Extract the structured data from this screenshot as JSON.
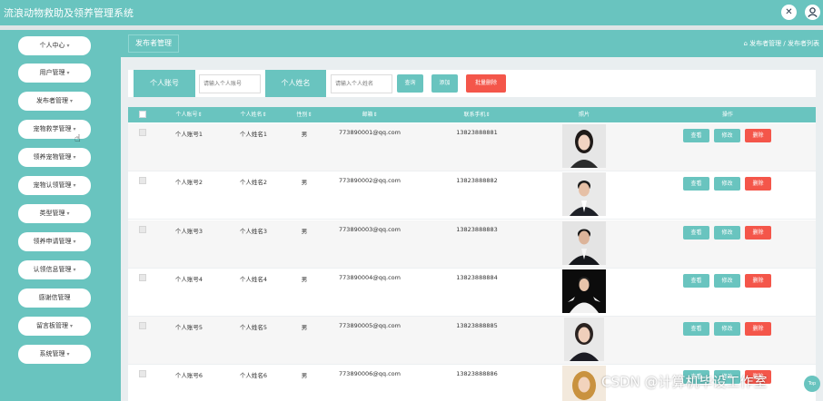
{
  "app": {
    "title": "流浪动物救助及领养管理系统",
    "accent_color": "#69c4bf",
    "danger_color": "#f4564a",
    "header_icons": [
      "close-x-icon",
      "user-icon"
    ]
  },
  "sidebar": {
    "items": [
      {
        "label": "个人中心"
      },
      {
        "label": "用户管理"
      },
      {
        "label": "发布者管理"
      },
      {
        "label": "宠物救学管理"
      },
      {
        "label": "领养宠物管理"
      },
      {
        "label": "宠物认领管理"
      },
      {
        "label": "类型管理"
      },
      {
        "label": "领养申请管理"
      },
      {
        "label": "认领信息管理"
      },
      {
        "label": "感谢信管理"
      },
      {
        "label": "留言板管理"
      },
      {
        "label": "系统管理"
      }
    ]
  },
  "header": {
    "tab": "发布者管理",
    "breadcrumb": {
      "home_icon": "home-icon",
      "level1": "发布者管理",
      "separator": "/",
      "level2": "发布者列表"
    }
  },
  "search": {
    "account_label": "个人账号",
    "account_placeholder": "请输入个人账号",
    "name_label": "个人姓名",
    "name_placeholder": "请输入个人姓名",
    "query_button": "查询",
    "add_button": "添加",
    "batch_delete_button": "批量删除"
  },
  "table": {
    "columns": [
      "个人账号",
      "个人姓名",
      "性别",
      "邮箱",
      "联系手机",
      "照片",
      "操作"
    ],
    "action_labels": {
      "view": "查看",
      "edit": "修改",
      "delete": "删除"
    },
    "rows": [
      {
        "account": "个人账号1",
        "name": "个人姓名1",
        "gender": "男",
        "email": "773890001@qq.com",
        "phone": "13823888881"
      },
      {
        "account": "个人账号2",
        "name": "个人姓名2",
        "gender": "男",
        "email": "773890002@qq.com",
        "phone": "13823888882"
      },
      {
        "account": "个人账号3",
        "name": "个人姓名3",
        "gender": "男",
        "email": "773890003@qq.com",
        "phone": "13823888883"
      },
      {
        "account": "个人账号4",
        "name": "个人姓名4",
        "gender": "男",
        "email": "773890004@qq.com",
        "phone": "13823888884"
      },
      {
        "account": "个人账号5",
        "name": "个人姓名5",
        "gender": "男",
        "email": "773890005@qq.com",
        "phone": "13823888885"
      },
      {
        "account": "个人账号6",
        "name": "个人姓名6",
        "gender": "男",
        "email": "773890006@qq.com",
        "phone": "13823888886"
      }
    ]
  },
  "watermark": "CSDN @计算机毕设工作室",
  "scroll_top_label": "Top"
}
